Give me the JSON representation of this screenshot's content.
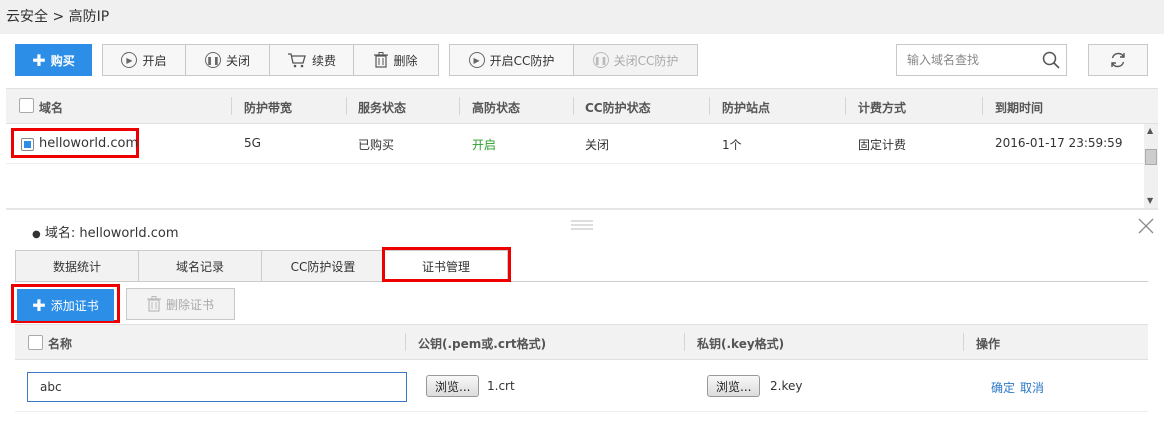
{
  "breadcrumb": "云安全 > 高防IP",
  "toolbar": {
    "buy": "购买",
    "start": "开启",
    "close": "关闭",
    "renew": "续费",
    "delete": "删除",
    "cc_on": "开启CC防护",
    "cc_off": "关闭CC防护"
  },
  "search": {
    "placeholder": "输入域名查找"
  },
  "table": {
    "headers": [
      "域名",
      "防护带宽",
      "服务状态",
      "高防状态",
      "CC防护状态",
      "防护站点",
      "计费方式",
      "到期时间"
    ],
    "rows": [
      [
        "helloworld.com",
        "5G",
        "已购买",
        "开启",
        "关闭",
        "1个",
        "固定计费",
        "2016-01-17 23:59:59"
      ]
    ]
  },
  "detail": {
    "domain_label": "域名: helloworld.com",
    "tabs": [
      "数据统计",
      "域名记录",
      "CC防护设置",
      "证书管理"
    ],
    "add_cert": "添加证书",
    "delete_cert": "删除证书",
    "cert_headers": [
      "名称",
      "公钥(.pem或.crt格式)",
      "私钥(.key格式)",
      "操作"
    ],
    "cert_row": {
      "name": "abc",
      "browse": "浏览...",
      "public_file": "1.crt",
      "private_file": "2.key",
      "confirm": "确定",
      "cancel": "取消"
    }
  },
  "colors": {
    "primary": "#2d8ee8",
    "highlight": "#e00000",
    "status_on": "#2aa02a",
    "link": "#2d78c8"
  }
}
